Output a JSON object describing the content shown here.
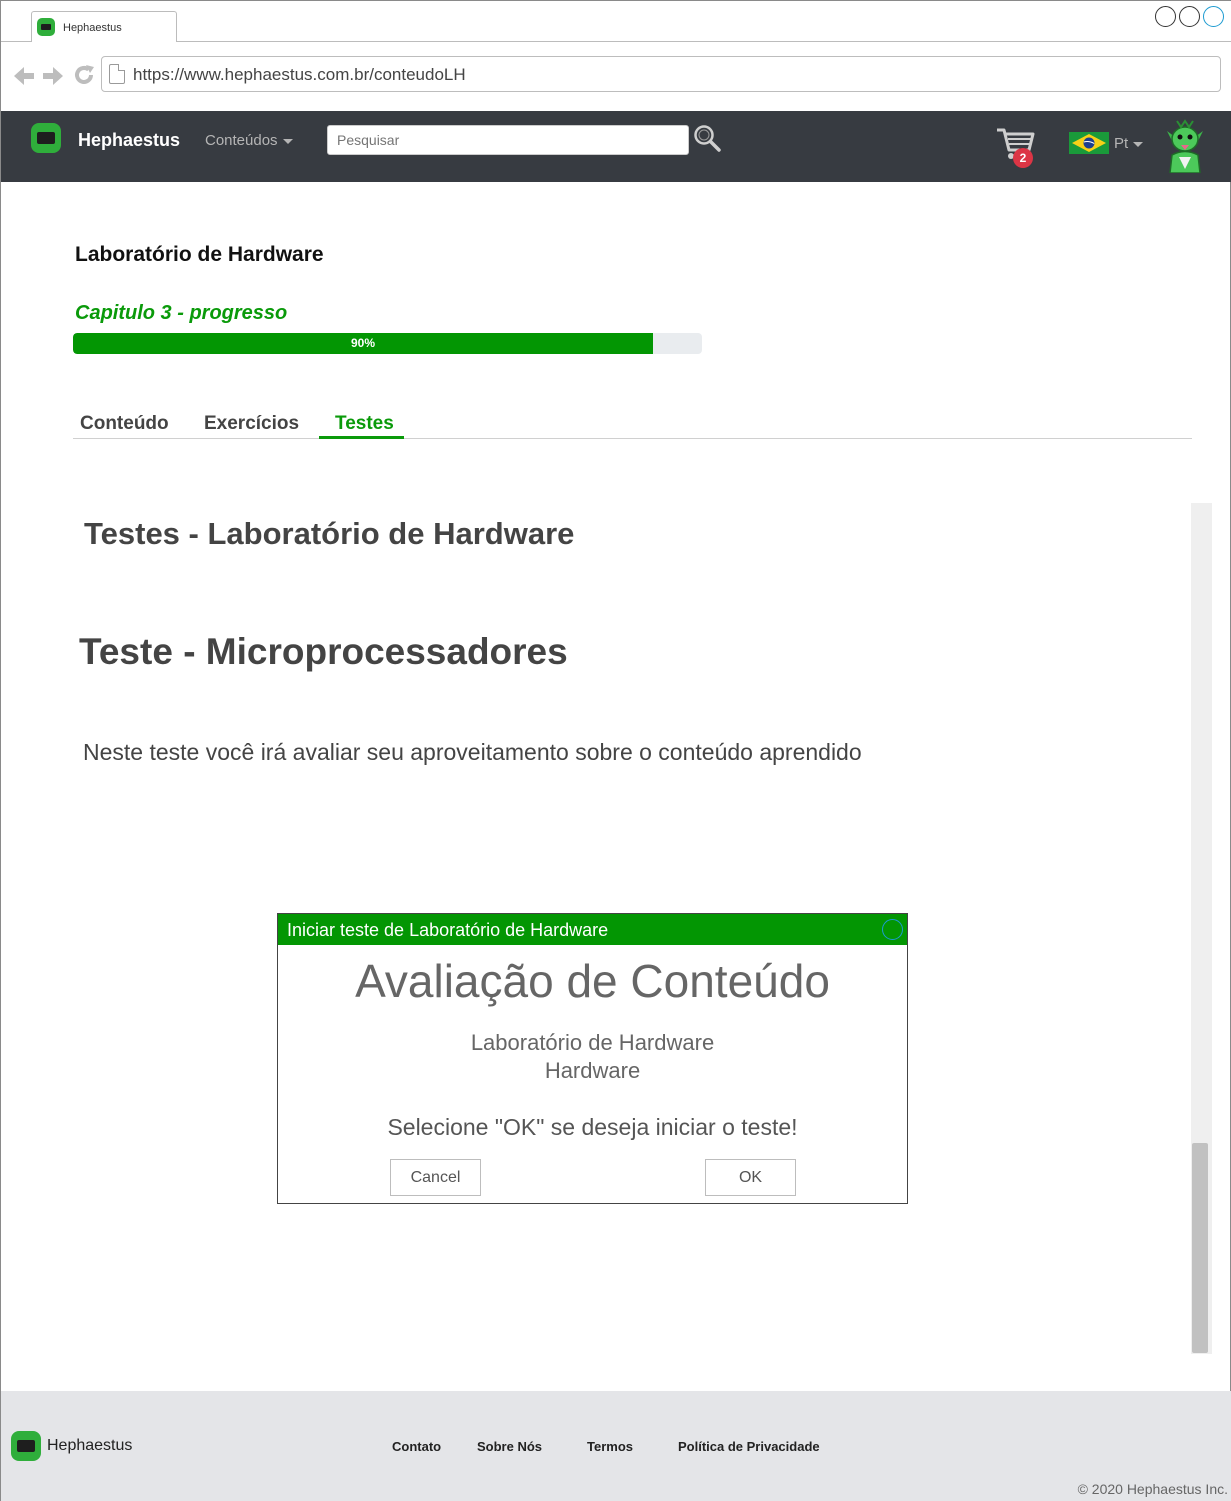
{
  "browser": {
    "tab_title": "Hephaestus",
    "url": "https://www.hephaestus.com.br/conteudoLH"
  },
  "navbar": {
    "brand": "Hephaestus",
    "menu_label": "Conteúdos",
    "search_placeholder": "Pesquisar",
    "cart_count": "2",
    "language": "Pt"
  },
  "course": {
    "title": "Laboratório de Hardware",
    "progress_label": "Capitulo 3 - progresso",
    "progress_percent": 90,
    "progress_text": "90%"
  },
  "tabs": [
    {
      "label": "Conteúdo",
      "active": false
    },
    {
      "label": "Exercícios",
      "active": false
    },
    {
      "label": "Testes",
      "active": true
    }
  ],
  "content": {
    "section_title": "Testes - Laboratório de Hardware",
    "test_title": "Teste - Microprocessadores",
    "description": "Neste teste você irá avaliar seu aproveitamento sobre o conteúdo aprendido"
  },
  "modal": {
    "header": "Iniciar teste de Laboratório de Hardware",
    "heading": "Avaliação de Conteúdo",
    "subtitle1": "Laboratório de Hardware",
    "subtitle2": "Hardware",
    "message": "Selecione \"OK\" se deseja iniciar o teste!",
    "cancel_label": "Cancel",
    "ok_label": "OK"
  },
  "footer": {
    "brand": "Hephaestus",
    "links": [
      "Contato",
      "Sobre Nós",
      "Termos",
      "Política de Privacidade"
    ],
    "copyright": "© 2020 Hephaestus Inc."
  },
  "colors": {
    "accent_green": "#039603",
    "navbar_bg": "#373b41",
    "badge_red": "#dc3545"
  }
}
